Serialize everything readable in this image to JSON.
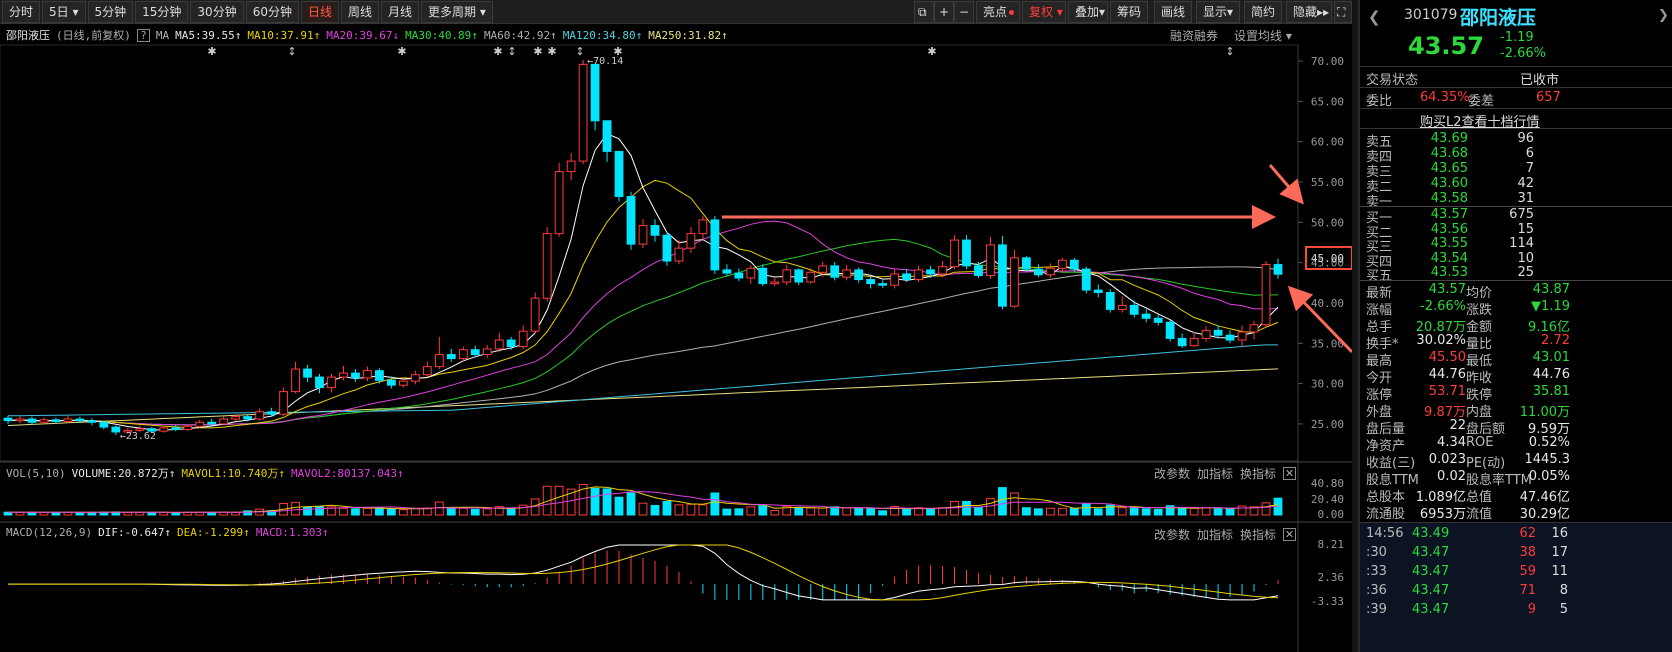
{
  "period_tabs": [
    "分时",
    "5日",
    "5分钟",
    "15分钟",
    "30分钟",
    "60分钟",
    "日线",
    "周线",
    "月线",
    "更多周期"
  ],
  "active_tab": "日线",
  "toolbar": {
    "fold": "⧉",
    "plus": "+",
    "minus": "−",
    "highlight": "亮点",
    "fq": "复权",
    "overlay": "叠加",
    "chips": "筹码",
    "draw": "画线",
    "display": "显示",
    "brief": "简约",
    "hide": "隐藏",
    "expand": "▸▸",
    "fullscreen": "⛶"
  },
  "info": {
    "stock": "邵阳液压",
    "mode": "(日线,前复权)",
    "help": "?",
    "ma": "MA",
    "ma5": "MA5:39.55",
    "ma10": "MA10:37.91",
    "ma20": "MA20:39.67",
    "ma30": "MA30:40.89",
    "ma60": "MA60:42.92",
    "ma120": "MA120:34.80",
    "ma250": "MA250:31.82",
    "margin": "融资融券",
    "setma": "设置均线"
  },
  "price_ticks": [
    "70.00",
    "65.00",
    "60.00",
    "55.00",
    "50.00",
    "45.00",
    "40.00",
    "35.00",
    "30.00",
    "25.00"
  ],
  "price_labels": {
    "high": "70.14",
    "low": "23.62"
  },
  "vol": {
    "name": "VOL(5,10)",
    "volume": "VOLUME:20.872万",
    "mavol1": "MAVOL1:10.740万",
    "mavol2": "MAVOL2:80137.043",
    "ticks": [
      "40.80",
      "20.40",
      "0.00"
    ]
  },
  "macd": {
    "name": "MACD(12,26,9)",
    "dif": "DIF:-0.647",
    "dea": "DEA:-1.299",
    "macd": "MACD:1.303",
    "ticks": [
      "8.21",
      "2.36",
      "-3.33"
    ]
  },
  "panel_actions": {
    "change": "改参数",
    "add": "加指标",
    "switch": "换指标",
    "close": "✕"
  },
  "quote": {
    "code": "301079",
    "name": "邵阳液压",
    "price": "43.57",
    "change": "-1.19",
    "pct": "-2.66%",
    "status_label": "交易状态",
    "status": "已收市",
    "wb_label": "委比",
    "wb": "64.35%",
    "wc_label": "委差",
    "wc": "657",
    "l2": "购买L2查看十档行情"
  },
  "asks": [
    [
      "卖五",
      "43.69",
      "96"
    ],
    [
      "卖四",
      "43.68",
      "6"
    ],
    [
      "卖三",
      "43.65",
      "7"
    ],
    [
      "卖二",
      "43.60",
      "42"
    ],
    [
      "卖一",
      "43.58",
      "31"
    ]
  ],
  "bids": [
    [
      "买一",
      "43.57",
      "675"
    ],
    [
      "买二",
      "43.56",
      "15"
    ],
    [
      "买三",
      "43.55",
      "114"
    ],
    [
      "买四",
      "43.54",
      "10"
    ],
    [
      "买五",
      "43.53",
      "25"
    ]
  ],
  "stats": [
    [
      "最新",
      "43.57",
      "均价",
      "43.87"
    ],
    [
      "涨幅",
      "-2.66%",
      "涨跌",
      "▼1.19"
    ],
    [
      "总手",
      "20.87万",
      "金额",
      "9.16亿"
    ],
    [
      "换手*",
      "30.02%",
      "量比",
      "2.72"
    ],
    [
      "最高",
      "45.50",
      "最低",
      "43.01"
    ],
    [
      "今开",
      "44.76",
      "昨收",
      "44.76"
    ],
    [
      "涨停",
      "53.71",
      "跌停",
      "35.81"
    ],
    [
      "外盘",
      "9.87万",
      "内盘",
      "11.00万"
    ],
    [
      "盘后量",
      "22",
      "盘后额",
      "9.59万"
    ],
    [
      "净资产",
      "4.34",
      "ROE",
      "0.52%"
    ],
    [
      "收益(三)",
      "0.023",
      "PE(动)",
      "1445.3"
    ],
    [
      "股息TTM",
      "0.02",
      "股息率TTM",
      "0.05%"
    ],
    [
      "总股本",
      "1.089亿",
      "总值",
      "47.46亿"
    ],
    [
      "流通股",
      "6953万",
      "流值",
      "30.29亿"
    ]
  ],
  "ticks": [
    [
      "14:56",
      "43.49",
      "62",
      "16"
    ],
    [
      ":30",
      "43.47",
      "38",
      "17"
    ],
    [
      ":33",
      "43.47",
      "59",
      "11"
    ],
    [
      ":36",
      "43.47",
      "71",
      "8"
    ],
    [
      ":39",
      "43.47",
      "9",
      "5"
    ]
  ],
  "annotation": {
    "box_value": "45.00"
  },
  "colors": {
    "up": "#ff3b3b",
    "down": "#00e5ff",
    "bg": "#000000",
    "ma5": "#ffffff",
    "ma10": "#e8d000",
    "ma20": "#e040e0",
    "ma30": "#28c828",
    "ma60": "#b0b0b0",
    "ma120": "#3fc0e0",
    "ma250": "#e8e080",
    "arrow": "#ff6a5a"
  },
  "chart_data": {
    "type": "candlestick",
    "y_range": [
      23,
      72
    ],
    "candles": [
      [
        25.7,
        25.4,
        26,
        25
      ],
      [
        25.4,
        25.6,
        26,
        25.1
      ],
      [
        25.6,
        25.2,
        25.9,
        24.9
      ],
      [
        25.2,
        25.5,
        25.8,
        25
      ],
      [
        25.5,
        25.3,
        25.8,
        25
      ],
      [
        25.3,
        25.6,
        26,
        25.1
      ],
      [
        25.6,
        25.4,
        25.9,
        25.1
      ],
      [
        25.4,
        25.2,
        25.7,
        24.8
      ],
      [
        25.2,
        24.6,
        25.4,
        24.3
      ],
      [
        24.6,
        24,
        24.8,
        23.62
      ],
      [
        24,
        24.2,
        24.5,
        23.8
      ],
      [
        24.2,
        24.4,
        24.8,
        24
      ],
      [
        24.4,
        24.1,
        24.6,
        23.9
      ],
      [
        24.1,
        24.5,
        24.8,
        23.9
      ],
      [
        24.5,
        24.3,
        24.8,
        24.1
      ],
      [
        24.3,
        24.7,
        25,
        24.1
      ],
      [
        24.7,
        25.2,
        25.5,
        24.5
      ],
      [
        25.2,
        25,
        25.6,
        24.8
      ],
      [
        25,
        25.6,
        25.9,
        24.8
      ],
      [
        25.6,
        25.9,
        26.2,
        25.4
      ],
      [
        25.9,
        25.6,
        26.2,
        25.3
      ],
      [
        25.6,
        26.5,
        26.9,
        25.4
      ],
      [
        26.5,
        26.2,
        27,
        26
      ],
      [
        26.2,
        29,
        29.5,
        26
      ],
      [
        29,
        31.8,
        32.7,
        28.8
      ],
      [
        31.8,
        30.8,
        32.3,
        30.2
      ],
      [
        30.8,
        29.5,
        31.2,
        28.8
      ],
      [
        29.5,
        30.8,
        31.2,
        28.9
      ],
      [
        30.8,
        31.3,
        32.2,
        30.4
      ],
      [
        31.3,
        30.7,
        31.8,
        30.2
      ],
      [
        30.7,
        31.6,
        32.1,
        30.3
      ],
      [
        31.6,
        30.4,
        31.9,
        30
      ],
      [
        30.4,
        29.8,
        30.9,
        29.4
      ],
      [
        29.8,
        30.3,
        30.8,
        29.5
      ],
      [
        30.3,
        31.1,
        31.6,
        29.9
      ],
      [
        31.1,
        32.1,
        32.7,
        30.8
      ],
      [
        32.1,
        33.6,
        35.8,
        31.8
      ],
      [
        33.6,
        33.1,
        34.3,
        32.7
      ],
      [
        33.1,
        34.2,
        34.6,
        32.8
      ],
      [
        34.2,
        33.6,
        34.7,
        33.3
      ],
      [
        33.6,
        34.3,
        34.8,
        33.2
      ],
      [
        34.3,
        35.4,
        36.3,
        33.9
      ],
      [
        35.4,
        34.6,
        35.8,
        34.2
      ],
      [
        34.6,
        36.5,
        37.2,
        34.3
      ],
      [
        36.5,
        40.6,
        41.3,
        36.2
      ],
      [
        40.6,
        48.6,
        49.4,
        40.2
      ],
      [
        48.6,
        56.3,
        57.4,
        48.2
      ],
      [
        56.3,
        57.6,
        58.6,
        55.2
      ],
      [
        57.6,
        69.6,
        70.14,
        57.2
      ],
      [
        69.6,
        62.6,
        66.3,
        61.4
      ],
      [
        62.6,
        58.8,
        61.2,
        57.5
      ],
      [
        58.8,
        53.2,
        58.3,
        52.6
      ],
      [
        53.2,
        47.3,
        53.8,
        46.6
      ],
      [
        47.3,
        49.6,
        50.4,
        46.8
      ],
      [
        49.6,
        48.4,
        50.4,
        47.6
      ],
      [
        48.4,
        45.2,
        48.8,
        44.6
      ],
      [
        45.2,
        46.8,
        47.8,
        44.8
      ],
      [
        46.8,
        48.6,
        49.4,
        46.2
      ],
      [
        48.6,
        50.3,
        50.8,
        47.8
      ],
      [
        50.3,
        44.1,
        50.8,
        43.6
      ],
      [
        44.1,
        43.7,
        44.8,
        43.3
      ],
      [
        43.7,
        43.1,
        44.3,
        42.7
      ],
      [
        43.1,
        44.3,
        44.7,
        42.4
      ],
      [
        44.3,
        42.4,
        44.8,
        42.1
      ],
      [
        42.4,
        42.6,
        43.1,
        42.1
      ],
      [
        42.6,
        44.1,
        44.7,
        42.2
      ],
      [
        44.1,
        42.6,
        44.3,
        42.2
      ],
      [
        42.6,
        43.8,
        44.3,
        42.4
      ],
      [
        43.8,
        44.6,
        45.1,
        43.2
      ],
      [
        44.6,
        43.2,
        45.1,
        42.8
      ],
      [
        43.2,
        44.1,
        44.7,
        42.8
      ],
      [
        44.1,
        42.9,
        44.4,
        42.5
      ],
      [
        42.9,
        42.4,
        43.4,
        41.8
      ],
      [
        42.4,
        42.2,
        42.8,
        41.9
      ],
      [
        42.2,
        43.6,
        44.2,
        41.8
      ],
      [
        43.6,
        42.9,
        44.2,
        42.6
      ],
      [
        42.9,
        44.1,
        44.6,
        42.6
      ],
      [
        44.1,
        43.6,
        44.6,
        43.1
      ],
      [
        43.6,
        44.5,
        45.2,
        43.2
      ],
      [
        44.5,
        47.8,
        48.4,
        44.2
      ],
      [
        47.8,
        44.6,
        48.4,
        44.2
      ],
      [
        44.6,
        43.4,
        45.1,
        43.1
      ],
      [
        43.4,
        47.2,
        48.2,
        43
      ],
      [
        47.2,
        39.6,
        48.3,
        39.2
      ],
      [
        39.6,
        45.6,
        46.6,
        39.4
      ],
      [
        45.6,
        44.2,
        45.8,
        43.8
      ],
      [
        44.2,
        43.5,
        44.8,
        43.2
      ],
      [
        43.5,
        44.3,
        44.9,
        43.1
      ],
      [
        44.3,
        45.3,
        45.6,
        43.8
      ],
      [
        45.3,
        44.2,
        45.6,
        43.8
      ],
      [
        44.2,
        41.6,
        44.5,
        41.2
      ],
      [
        41.6,
        41.3,
        42.3,
        40.7
      ],
      [
        41.3,
        39.2,
        41.7,
        38.8
      ],
      [
        39.2,
        39.7,
        40.8,
        38.8
      ],
      [
        39.7,
        38.6,
        40.3,
        38.2
      ],
      [
        38.6,
        38.1,
        39.2,
        37.6
      ],
      [
        38.1,
        37.6,
        38.6,
        37.2
      ],
      [
        37.6,
        35.6,
        37.9,
        35.2
      ],
      [
        35.6,
        34.7,
        36.2,
        34.4
      ],
      [
        34.7,
        35.6,
        36.4,
        34.6
      ],
      [
        35.6,
        36.6,
        37.1,
        35.2
      ],
      [
        36.6,
        36,
        37.2,
        35.6
      ],
      [
        36,
        35.4,
        36.6,
        35
      ],
      [
        35.4,
        36.4,
        37.2,
        34.6
      ],
      [
        36.4,
        37.3,
        37.8,
        35.5
      ],
      [
        37.3,
        44.76,
        45.2,
        37
      ],
      [
        44.76,
        43.57,
        45.5,
        43.01
      ]
    ]
  }
}
